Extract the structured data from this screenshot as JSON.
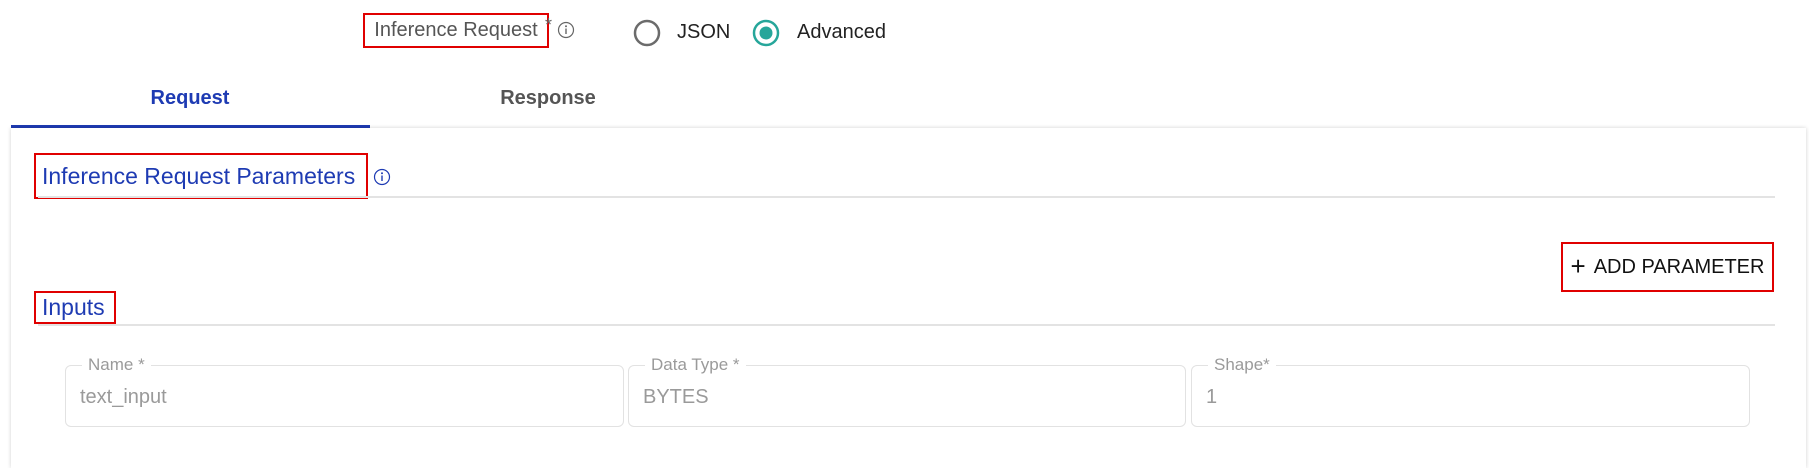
{
  "header": {
    "label": "Inference Request",
    "required_mark": "*",
    "info_icon": "info-icon",
    "format_options": [
      {
        "label": "JSON",
        "selected": false
      },
      {
        "label": "Advanced",
        "selected": true
      }
    ],
    "accent_color": "#26a69a"
  },
  "tabs": [
    {
      "label": "Request",
      "active": true
    },
    {
      "label": "Response",
      "active": false
    }
  ],
  "parameters": {
    "title": "Inference Request Parameters",
    "info_icon": "info-icon",
    "add_button": "ADD PARAMETER",
    "add_icon": "plus-icon"
  },
  "inputs": {
    "title": "Inputs",
    "fields": [
      {
        "label": "Name *",
        "value": "text_input"
      },
      {
        "label": "Data Type *",
        "value": "BYTES"
      },
      {
        "label": "Shape*",
        "value": "1"
      }
    ]
  },
  "colors": {
    "primary": "#1e3bb3",
    "highlight": "#e00000"
  }
}
